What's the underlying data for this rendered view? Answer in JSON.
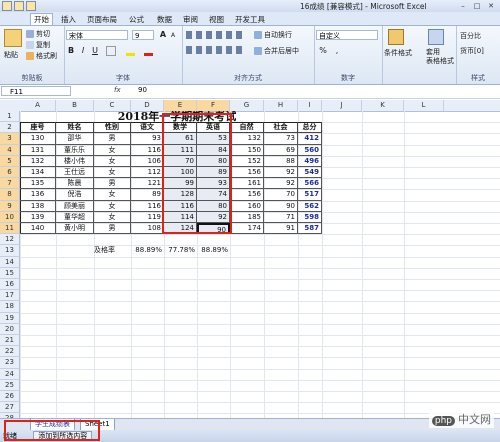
{
  "window": {
    "title": "16成绩 [兼容模式] - Microsoft Excel",
    "controls": [
      "–",
      "□",
      "✕"
    ]
  },
  "ribbon_tabs": [
    "开始",
    "插入",
    "页面布局",
    "公式",
    "数据",
    "审阅",
    "视图",
    "开发工具"
  ],
  "ribbon": {
    "clipboard": {
      "paste": "粘贴",
      "cut": "剪切",
      "copy": "复制",
      "format_painter": "格式刷",
      "label": "剪贴板"
    },
    "font": {
      "name": "宋体",
      "size": "9",
      "bold": "B",
      "italic": "I",
      "underline": "U",
      "label": "字体",
      "grow": "A",
      "shrink": "A"
    },
    "alignment": {
      "wrap": "自动换行",
      "merge": "合并后居中",
      "label": "对齐方式"
    },
    "number": {
      "format": "自定义",
      "percent": "%",
      "comma": ",",
      "label": "数字"
    },
    "styles": {
      "conditional": "条件格式",
      "table": "套用\n表格格式",
      "label": "样式"
    },
    "cell_styles": {
      "percent": "百分比",
      "currency": "货币[0]"
    }
  },
  "formula_bar": {
    "name_box": "F11",
    "fx": "fx",
    "value": "90"
  },
  "columns": [
    "A",
    "B",
    "C",
    "D",
    "E",
    "F",
    "G",
    "H",
    "I",
    "J",
    "K",
    "L"
  ],
  "rows": [
    "1",
    "2",
    "3",
    "4",
    "5",
    "6",
    "7",
    "8",
    "9",
    "10",
    "11",
    "12",
    "13",
    "14",
    "15",
    "16",
    "17",
    "18",
    "19",
    "20",
    "21",
    "22",
    "23",
    "24",
    "25",
    "26",
    "27",
    "28",
    "29"
  ],
  "sheet": {
    "title": "2018年一学期期末考试",
    "headers": [
      "座号",
      "姓名",
      "性别",
      "语文",
      "数学",
      "英语",
      "自然",
      "社会",
      "总分"
    ],
    "records": [
      [
        "130",
        "邵华",
        "男",
        "93",
        "61",
        "53",
        "132",
        "73",
        "412"
      ],
      [
        "131",
        "董乐乐",
        "女",
        "116",
        "111",
        "84",
        "150",
        "69",
        "560"
      ],
      [
        "132",
        "楼小伟",
        "女",
        "106",
        "70",
        "80",
        "152",
        "88",
        "496"
      ],
      [
        "134",
        "王仕远",
        "女",
        "112",
        "100",
        "89",
        "156",
        "92",
        "549"
      ],
      [
        "135",
        "陈晨",
        "男",
        "121",
        "99",
        "93",
        "161",
        "92",
        "566"
      ],
      [
        "136",
        "倪浩",
        "女",
        "89",
        "128",
        "74",
        "156",
        "70",
        "517"
      ],
      [
        "138",
        "顾美丽",
        "女",
        "116",
        "116",
        "80",
        "160",
        "90",
        "562"
      ],
      [
        "139",
        "董华超",
        "女",
        "119",
        "114",
        "92",
        "185",
        "71",
        "598"
      ],
      [
        "140",
        "黄小明",
        "男",
        "108",
        "124",
        "90",
        "174",
        "91",
        "587"
      ]
    ],
    "pass_rate": {
      "label": "及格率",
      "values": [
        "88.89%",
        "77.78%",
        "88.89%"
      ]
    }
  },
  "sheet_tabs": [
    "学生成绩表",
    "Sheet1"
  ],
  "status_bar": {
    "ready": "就绪",
    "button": "添加到所选内容"
  },
  "watermark": {
    "logo": "php",
    "text": "中文网"
  }
}
